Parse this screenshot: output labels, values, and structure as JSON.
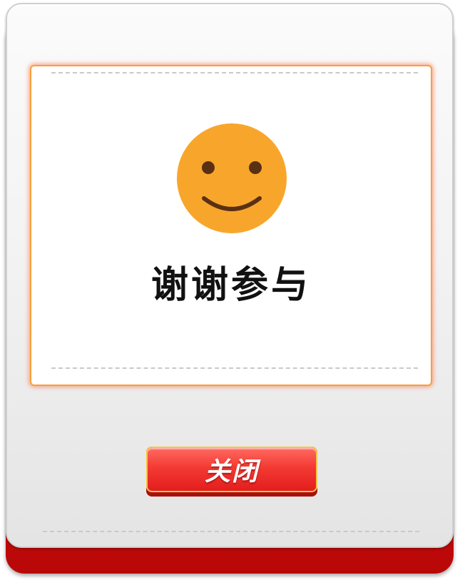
{
  "dialog": {
    "result_text": "谢谢参与",
    "close_label": "关闭",
    "icon": "smiley-face-icon"
  },
  "colors": {
    "accent_red": "#e31e1e",
    "smiley_orange": "#f8a62b",
    "card_border": "#f5a03c"
  }
}
